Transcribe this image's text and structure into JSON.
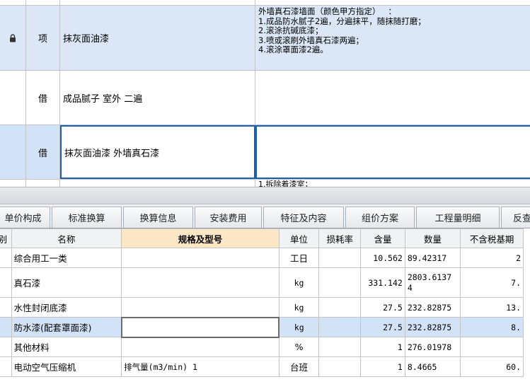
{
  "top_rows": [
    {
      "lock_icon": "lock-icon",
      "type": "项",
      "name": "抹灰面油漆",
      "description": "外墙真石漆墙面（颜色甲方指定）   ：\n1.成品防水腻子2遍，分遍抹平，随抹随打磨；\n2.滚涂抗碱底漆；\n3.喷或滚刷外墙真石漆两遍；\n4.滚涂罩面漆2遍。"
    },
    {
      "type": "借",
      "name": "成品腻子 室外 二遍",
      "description": ""
    },
    {
      "type": "借",
      "name": "抹灰面油漆 外墙真石漆",
      "description": ""
    }
  ],
  "cut_text": "1.拆除着漆室；",
  "tabs": [
    "单价构成",
    "标准换算",
    "换算信息",
    "安装费用",
    "特征及内容",
    "组价方案",
    "工程量明细",
    "反查"
  ],
  "columns": [
    "别",
    "名称",
    "规格及型号",
    "单位",
    "损耗率",
    "含量",
    "数量",
    "不含税基期"
  ],
  "rows": [
    {
      "name": "综合用工一类",
      "spec": "",
      "unit": "工日",
      "loss": "",
      "content": "10.562",
      "qty": "89.42317",
      "price": "2"
    },
    {
      "name": "真石漆",
      "spec": "",
      "unit": "kg",
      "loss": "",
      "content": "331.142",
      "qty": "2803.6137\n4",
      "price": "7."
    },
    {
      "name": "水性封闭底漆",
      "spec": "",
      "unit": "kg",
      "loss": "",
      "content": "27.5",
      "qty": "232.82875",
      "price": "13."
    },
    {
      "name": "防水漆(配套罩面漆)",
      "spec": "",
      "unit": "kg",
      "loss": "",
      "content": "27.5",
      "qty": "232.82875",
      "price": "8."
    },
    {
      "name": "其他材料",
      "spec": "",
      "unit": "%",
      "loss": "",
      "content": "1",
      "qty": "276.01978",
      "price": ""
    },
    {
      "name": "电动空气压缩机",
      "spec": "排气量(m3/min) 1",
      "unit": "台班",
      "loss": "",
      "content": "1",
      "qty": "8.4665",
      "price": "60."
    }
  ]
}
